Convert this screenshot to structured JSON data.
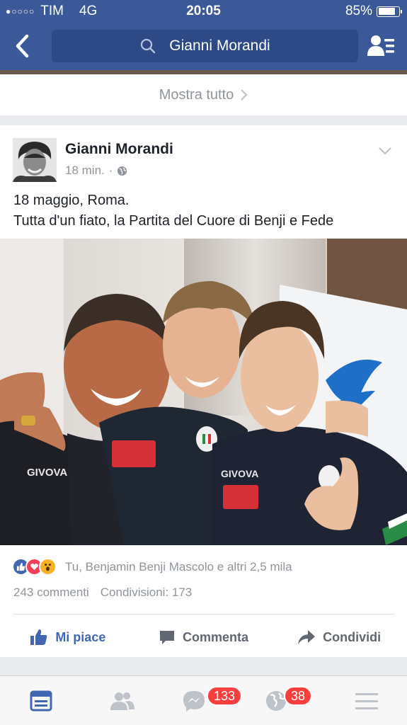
{
  "status_bar": {
    "carrier": "TIM",
    "network": "4G",
    "time": "20:05",
    "battery": "85%",
    "battery_level": 0.85
  },
  "nav": {
    "search_value": "Gianni Morandi",
    "back_icon": "chevron-left-icon",
    "friends_icon": "friends-list-icon"
  },
  "show_all": {
    "label": "Mostra tutto"
  },
  "post": {
    "author": "Gianni Morandi",
    "time": "18 min.",
    "separator": "·",
    "privacy_icon": "globe-icon",
    "text_line1": "18 maggio, Roma.",
    "text_line2": "Tutta d'un fiato, la Partita del Cuore di Benji e Fede",
    "reactions_text": "Tu, Benjamin Benji Mascolo e altri 2,5 mila",
    "comments": "243 commenti",
    "shares": "Condivisioni: 173",
    "actions": {
      "like": "Mi piace",
      "comment": "Commenta",
      "share": "Condividi"
    }
  },
  "tabs": {
    "messages_badge": "133",
    "notifications_badge": "38"
  },
  "colors": {
    "brand": "#3b5998",
    "badge": "#fa3e3e",
    "like": "#4267b2"
  }
}
